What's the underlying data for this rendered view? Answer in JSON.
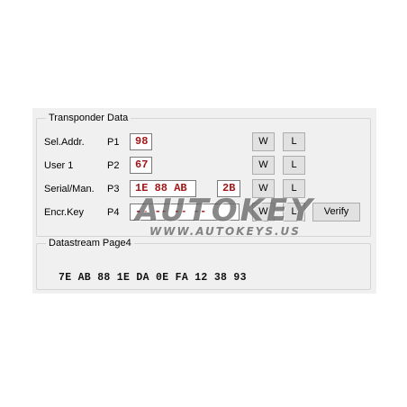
{
  "transponder": {
    "title": "Transponder Data",
    "rows": [
      {
        "label": "Sel.Addr.",
        "reg": "P1",
        "value": "98",
        "extra": "",
        "write": "W",
        "lock": "L"
      },
      {
        "label": "User 1",
        "reg": "P2",
        "value": "67",
        "extra": "",
        "write": "W",
        "lock": "L"
      },
      {
        "label": "Serial/Man.",
        "reg": "P3",
        "value": "1E 88 AB",
        "extra": "2B",
        "write": "W",
        "lock": "L"
      },
      {
        "label": "Encr.Key",
        "reg": "P4",
        "value": "-- -- -- --",
        "extra": "",
        "write": "W",
        "lock": "L"
      }
    ],
    "verify_label": "Verify"
  },
  "datastream": {
    "title": "Datastream Page4",
    "bytes": "7E AB 88 1E DA 0E FA 12 38 93"
  },
  "watermark": {
    "logo": "AUTOKEY",
    "url": "WWW.AUTOKEYS.US"
  }
}
